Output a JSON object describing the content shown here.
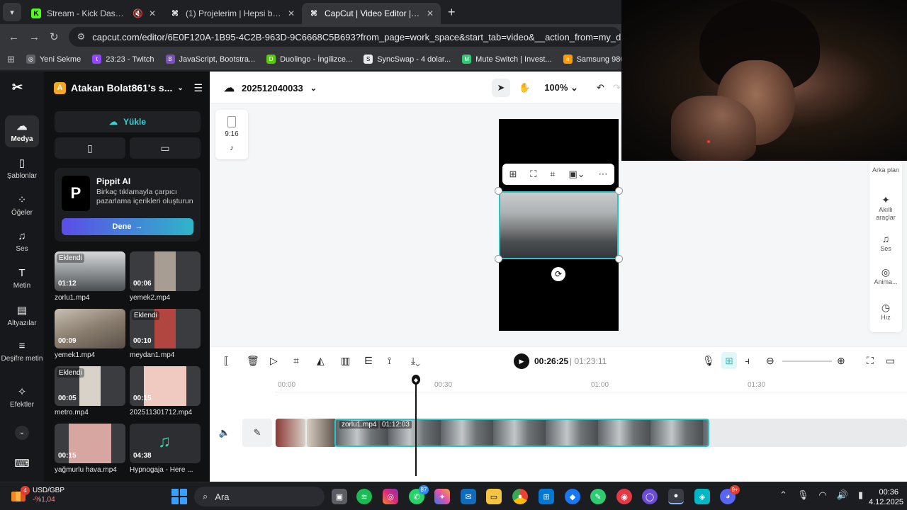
{
  "browser": {
    "tabs": [
      {
        "title": "Stream - Kick Dashboard",
        "icon": "K",
        "color": "#53fc18"
      },
      {
        "title": "(1) Projelerim | Hepsi bir arada",
        "icon": "CC",
        "color": "#ffffff"
      },
      {
        "title": "CapCut | Video Editor | All-In-One",
        "icon": "CC",
        "color": "#ffffff"
      }
    ],
    "url": "capcut.com/editor/6E0F120A-1B95-4C2B-963D-9C6668C5B693?from_page=work_space&start_tab=video&__action_from=my_draft&position=my",
    "bookmarks": [
      {
        "label": "Yeni Sekme",
        "color": "#5f6368"
      },
      {
        "label": "23:23 - Twitch",
        "color": "#9146ff"
      },
      {
        "label": "JavaScript, Bootstra...",
        "color": "#7952b3"
      },
      {
        "label": "Duolingo - İngilizce...",
        "color": "#58cc02"
      },
      {
        "label": "SyncSwap - 4 dolar...",
        "color": "#e8eaed"
      },
      {
        "label": "Mute Switch | Invest...",
        "color": "#2ecc71"
      },
      {
        "label": "Samsung 980 PRO...",
        "color": "#ff9900"
      }
    ]
  },
  "sidebar": {
    "items": [
      {
        "label": "Medya",
        "icon": "cloud-media-icon"
      },
      {
        "label": "Şablonlar",
        "icon": "templates-icon"
      },
      {
        "label": "Öğeler",
        "icon": "elements-icon"
      },
      {
        "label": "Ses",
        "icon": "music-icon"
      },
      {
        "label": "Metin",
        "icon": "text-icon"
      },
      {
        "label": "Altyazılar",
        "icon": "captions-icon"
      },
      {
        "label": "Deşifre metin",
        "icon": "transcript-icon"
      },
      {
        "label": "Efektler",
        "icon": "effects-icon"
      }
    ]
  },
  "panel": {
    "workspace": "Atakan Bolat861's s...",
    "workspace_initial": "A",
    "upload_label": "Yükle",
    "pippit": {
      "title": "Pippit AI",
      "desc": "Birkaç tıklamayla çarpıcı pazarlama içerikleri oluşturun",
      "button": "Dene"
    },
    "added_label": "Eklendi",
    "media": [
      {
        "name": "zorlu1.mp4",
        "dur": "01:12",
        "added": true
      },
      {
        "name": "yemek2.mp4",
        "dur": "00:06",
        "added": false
      },
      {
        "name": "yemek1.mp4",
        "dur": "00:09",
        "added": false
      },
      {
        "name": "meydan1.mp4",
        "dur": "00:10",
        "added": true
      },
      {
        "name": "metro.mp4",
        "dur": "00:05",
        "added": true
      },
      {
        "name": "202511301712.mp4",
        "dur": "00:15",
        "added": false
      },
      {
        "name": "yağmurlu hava.mp4",
        "dur": "00:15",
        "added": false
      },
      {
        "name": "Hypnogaja - Here ...",
        "dur": "04:38",
        "added": false
      }
    ]
  },
  "editor": {
    "project_name": "202512040033",
    "zoom": "100%",
    "ratio": "9:16",
    "right_tools": [
      {
        "label": "Arka plan",
        "icon": "background-icon"
      },
      {
        "label": "Akıllı araçlar",
        "icon": "sparkle-icon"
      },
      {
        "label": "Ses",
        "icon": "music-icon"
      },
      {
        "label": "Anima...",
        "icon": "animation-icon"
      },
      {
        "label": "Hız",
        "icon": "speed-icon"
      }
    ]
  },
  "timeline": {
    "current_time": "00:26:25",
    "total_time": "01:23:11",
    "ticks": [
      "00:00",
      "00:30",
      "01:00",
      "01:30"
    ],
    "clip_name": "zorlu1.mp4",
    "clip_duration": "01:12:03"
  },
  "taskbar": {
    "ticker_symbol": "USD/GBP",
    "ticker_change": "-%1,04",
    "ticker_badge": "4",
    "search_label": "Ara",
    "whatsapp_badge": "87",
    "discord_badge": "9+",
    "time": "00:36",
    "date": "4.12.2025"
  }
}
